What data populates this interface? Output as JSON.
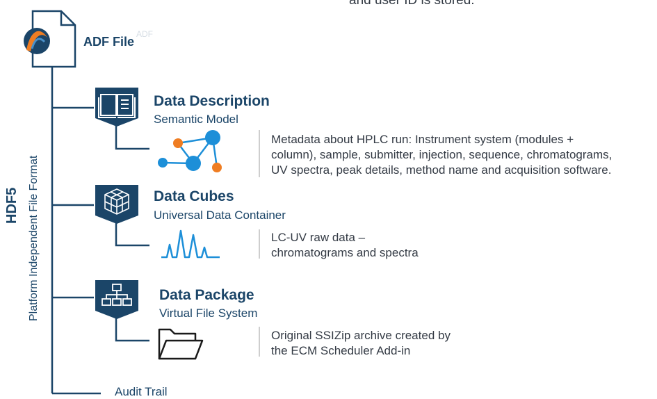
{
  "top_text": "and user ID is stored.",
  "adf_file": {
    "label": "ADF File",
    "logo_watermark": "ADF"
  },
  "vertical": {
    "title": "HDF5",
    "subtitle": "Platform Independent File Format"
  },
  "sections": [
    {
      "title": "Data Description",
      "subtitle": "Semantic Model",
      "description_lines": [
        "Metadata about HPLC run: Instrument system (modules +",
        "column), sample, submitter, injection, sequence, chromatograms,",
        "UV spectra, peak details, method name and acquisition software."
      ],
      "header_icon": "open-book-icon",
      "sub_icon": "network-graph-icon"
    },
    {
      "title": "Data Cubes",
      "subtitle": "Universal Data Container",
      "description_lines": [
        "LC-UV raw data –",
        "chromatograms and spectra"
      ],
      "header_icon": "cubes-icon",
      "sub_icon": "chromatogram-peaks-icon"
    },
    {
      "title": "Data Package",
      "subtitle": "Virtual File System",
      "description_lines": [
        "Original SSIZip archive created by",
        "the ECM Scheduler Add-in"
      ],
      "header_icon": "hierarchy-icon",
      "sub_icon": "folder-icon"
    }
  ],
  "audit_trail": "Audit Trail",
  "colors": {
    "navy": "#1b4568",
    "blue": "#1d8fd8",
    "orange": "#ef7d22",
    "divider": "#bdbdbd"
  }
}
